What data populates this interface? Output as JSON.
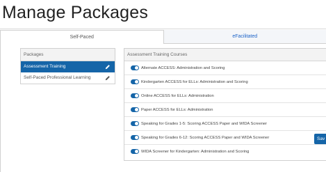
{
  "page": {
    "title": "Manage Packages"
  },
  "tabs": [
    {
      "label": "Self-Paced"
    },
    {
      "label": "eFacilitated"
    }
  ],
  "packages": {
    "header": "Packages",
    "items": [
      {
        "label": "Assessment Training",
        "icon": "pencil-icon"
      },
      {
        "label": "Self-Paced Professional Learning",
        "icon": "pencil-icon"
      }
    ]
  },
  "courses": {
    "header": "Assessment Training Courses",
    "items": [
      {
        "label": "Alternate ACCESS: Administration and Scoring",
        "enabled": true
      },
      {
        "label": "Kindergarten ACCESS for ELLs: Administration and Scoring",
        "enabled": true
      },
      {
        "label": "Online ACCESS for ELLs: Administration",
        "enabled": true
      },
      {
        "label": "Paper ACCESS for ELLs: Administration",
        "enabled": true
      },
      {
        "label": "Speaking for Grades 1-5: Scoring ACCESS Paper and WIDA Screener",
        "enabled": true
      },
      {
        "label": "Speaking for Grades 6-12: Scoring ACCESS Paper and WIDA Screener",
        "enabled": true
      },
      {
        "label": "WIDA Screener for Kindergarten: Administration and Scoring",
        "enabled": true
      }
    ]
  },
  "actions": {
    "save_label": "Sav"
  },
  "colors": {
    "accent": "#1565a8",
    "link": "#1e64c8"
  }
}
